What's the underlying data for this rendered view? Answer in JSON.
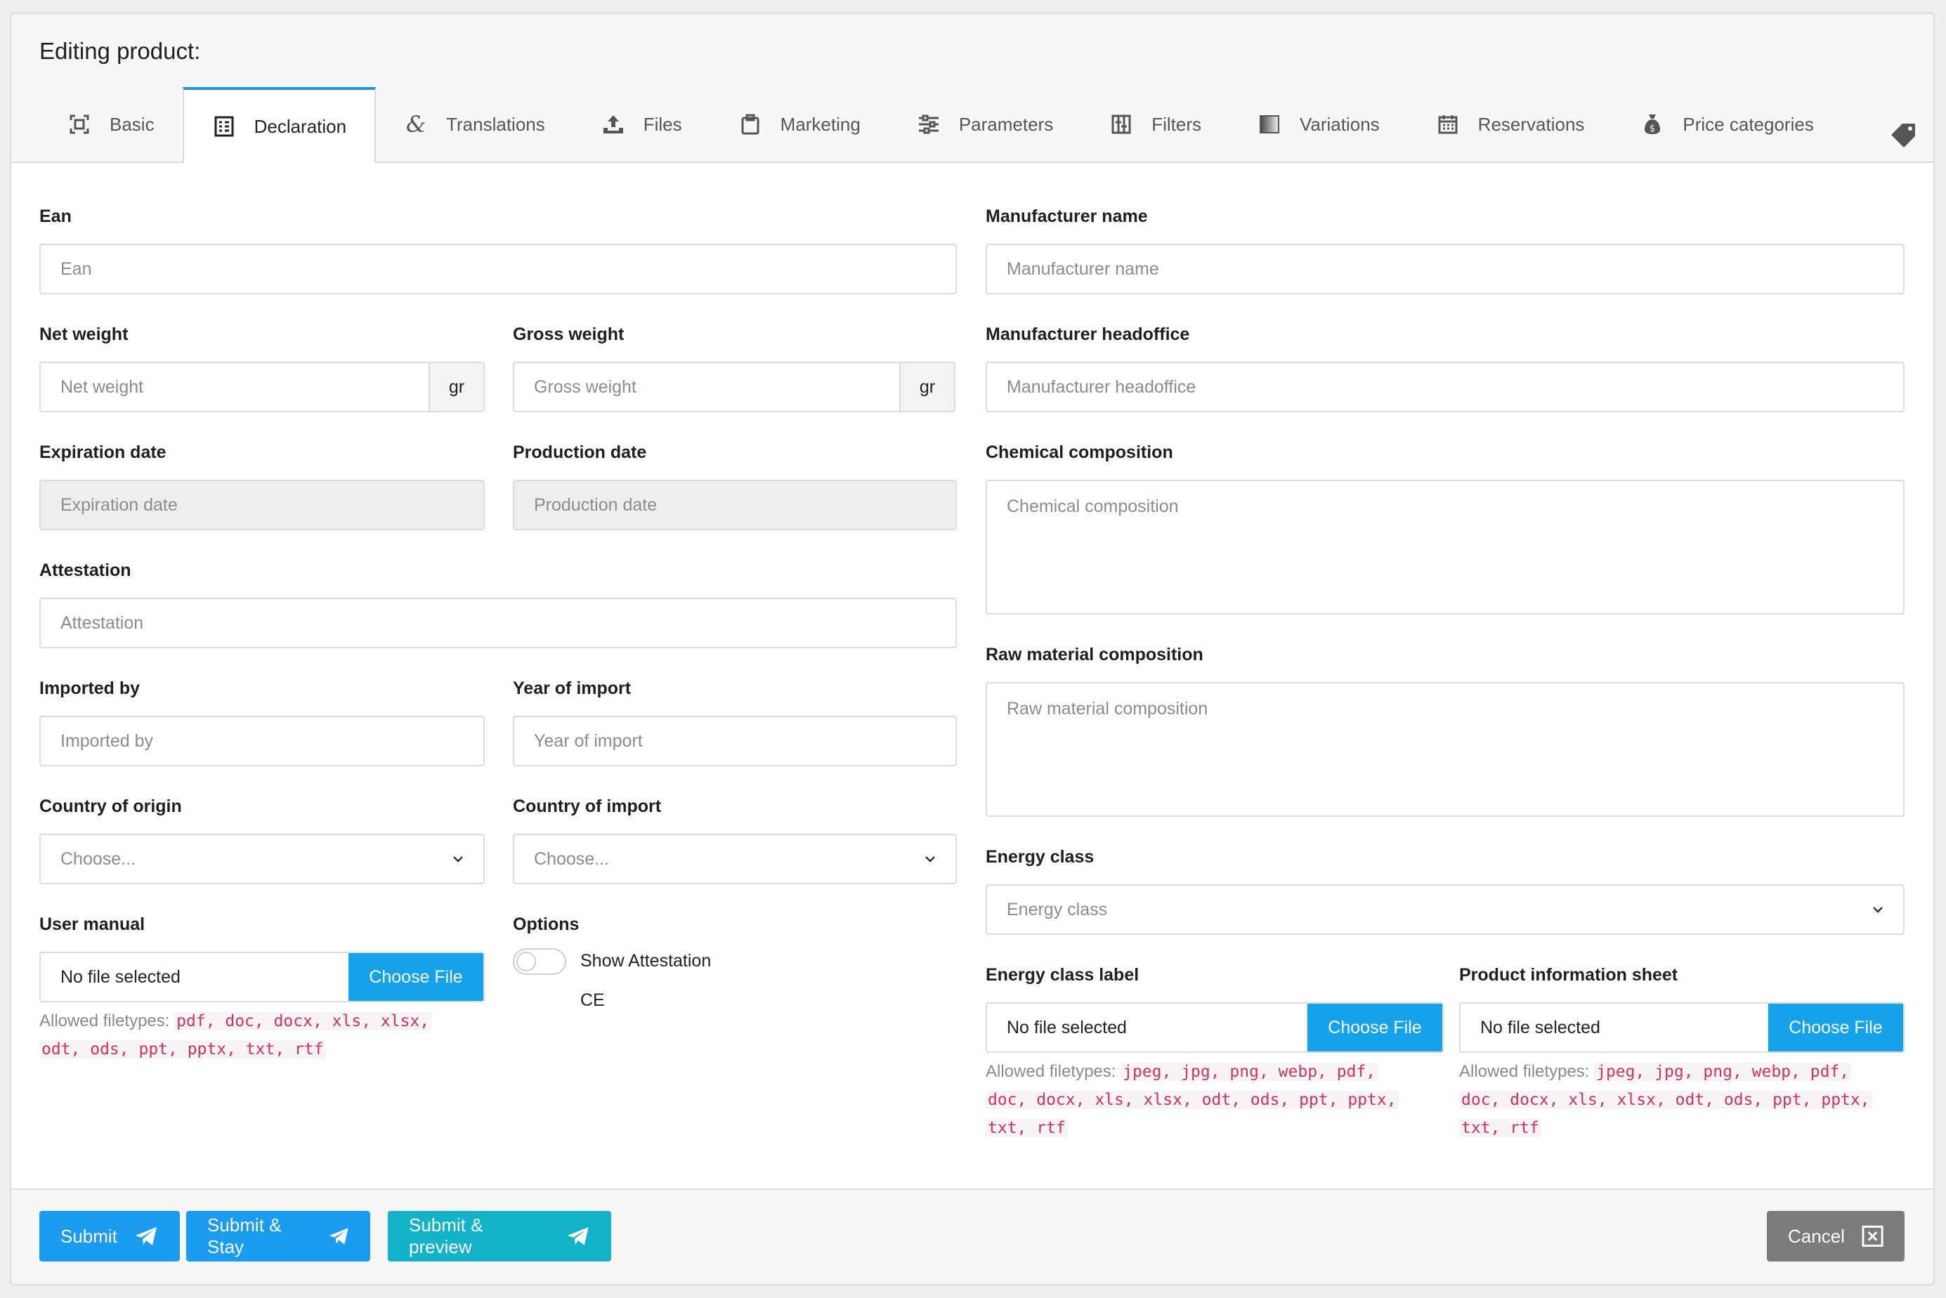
{
  "header": {
    "title": "Editing product:"
  },
  "tabs": [
    {
      "label": "Basic",
      "icon": "expand-icon"
    },
    {
      "label": "Declaration",
      "icon": "document-list-icon"
    },
    {
      "label": "Translations",
      "icon": "ampersand-icon"
    },
    {
      "label": "Files",
      "icon": "upload-icon"
    },
    {
      "label": "Marketing",
      "icon": "clipboard-icon"
    },
    {
      "label": "Parameters",
      "icon": "sliders-icon"
    },
    {
      "label": "Filters",
      "icon": "filter-grid-icon"
    },
    {
      "label": "Variations",
      "icon": "gradient-icon"
    },
    {
      "label": "Reservations",
      "icon": "calendar-icon"
    },
    {
      "label": "Price categories",
      "icon": "money-bag-icon"
    }
  ],
  "form": {
    "ean": {
      "label": "Ean",
      "placeholder": "Ean"
    },
    "net_weight": {
      "label": "Net weight",
      "placeholder": "Net weight",
      "unit": "gr"
    },
    "gross_weight": {
      "label": "Gross weight",
      "placeholder": "Gross weight",
      "unit": "gr"
    },
    "expiration_date": {
      "label": "Expiration date",
      "placeholder": "Expiration date"
    },
    "production_date": {
      "label": "Production date",
      "placeholder": "Production date"
    },
    "attestation": {
      "label": "Attestation",
      "placeholder": "Attestation"
    },
    "imported_by": {
      "label": "Imported by",
      "placeholder": "Imported by"
    },
    "year_of_import": {
      "label": "Year of import",
      "placeholder": "Year of import"
    },
    "country_of_origin": {
      "label": "Country of origin",
      "value": "Choose..."
    },
    "country_of_import": {
      "label": "Country of import",
      "value": "Choose..."
    },
    "user_manual": {
      "label": "User manual",
      "file_text": "No file selected",
      "button": "Choose File",
      "hint_prefix": "Allowed filetypes:",
      "types_line1": "pdf, doc, docx, xls, xlsx,",
      "types_line2": "odt, ods, ppt, pptx, txt, rtf"
    },
    "options": {
      "label": "Options",
      "toggle_label": "Show Attestation",
      "ce": "CE"
    },
    "manufacturer_name": {
      "label": "Manufacturer name",
      "placeholder": "Manufacturer name"
    },
    "manufacturer_headoffice": {
      "label": "Manufacturer headoffice",
      "placeholder": "Manufacturer headoffice"
    },
    "chemical_composition": {
      "label": "Chemical composition",
      "placeholder": "Chemical composition"
    },
    "raw_material_composition": {
      "label": "Raw material composition",
      "placeholder": "Raw material composition"
    },
    "energy_class": {
      "label": "Energy class",
      "value": "Energy class"
    },
    "energy_class_label": {
      "label": "Energy class label",
      "file_text": "No file selected",
      "button": "Choose File",
      "hint_prefix": "Allowed filetypes:",
      "types_line1": "jpeg, jpg, png, webp, pdf,",
      "types_line2": "doc, docx, xls, xlsx, odt, ods, ppt, pptx,",
      "types_line3": "txt, rtf"
    },
    "product_information_sheet": {
      "label": "Product information sheet",
      "file_text": "No file selected",
      "button": "Choose File",
      "hint_prefix": "Allowed filetypes:",
      "types_line1": "jpeg, jpg, png, webp, pdf,",
      "types_line2": "doc, docx, xls, xlsx, odt, ods, ppt, pptx,",
      "types_line3": "txt, rtf"
    }
  },
  "footer": {
    "submit": "Submit",
    "submit_stay": "Submit & Stay",
    "submit_preview": "Submit & preview",
    "cancel": "Cancel"
  },
  "colors": {
    "accent": "#1a9cf0",
    "teal": "#12b3c9",
    "cancel": "#7b7b7b",
    "code": "#d1335b",
    "active_tab_border": "#2a8fe0"
  }
}
